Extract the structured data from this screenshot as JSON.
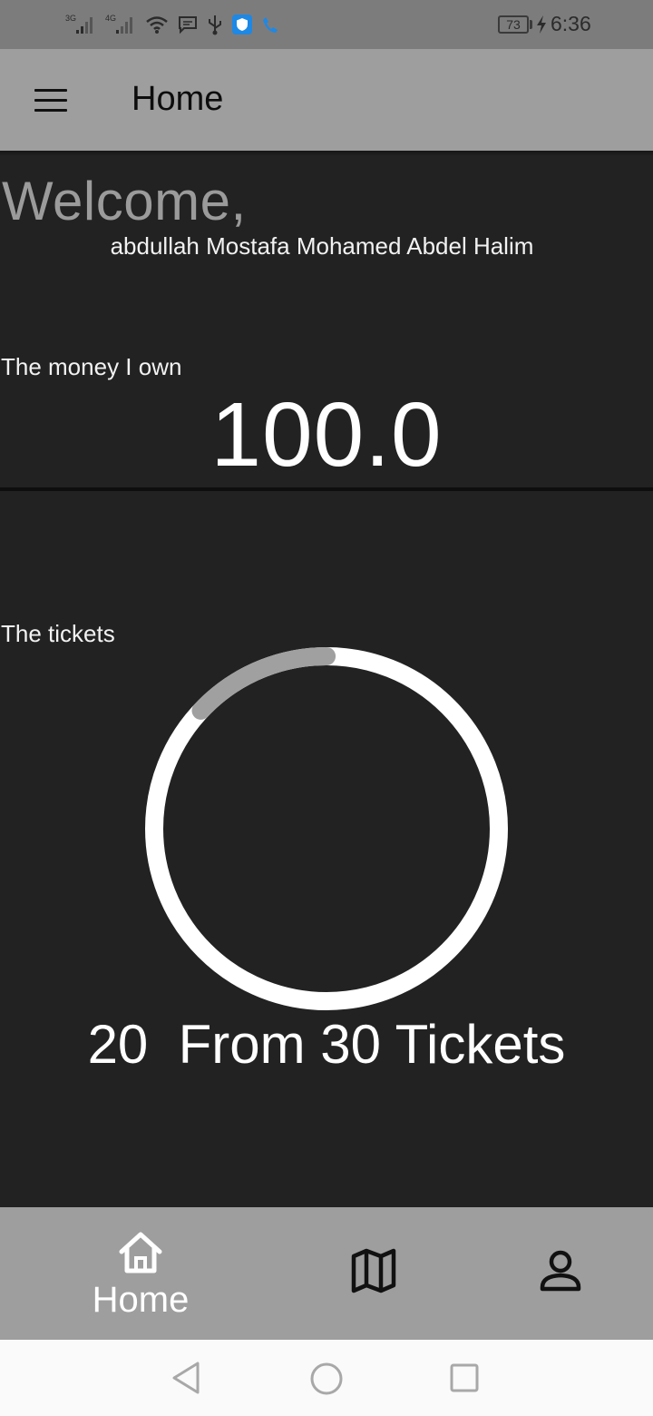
{
  "status_bar": {
    "signal_1_label": "3G",
    "signal_2_label": "4G",
    "battery_level": "73",
    "time": "6:36",
    "icons": [
      "signal-3g-icon",
      "signal-4g-icon",
      "wifi-icon",
      "message-icon",
      "usb-icon",
      "shield-app-icon",
      "phone-call-icon",
      "battery-icon",
      "charging-bolt-icon"
    ]
  },
  "app_bar": {
    "title": "Home",
    "menu_icon": "hamburger-menu-icon"
  },
  "main": {
    "welcome": "Welcome,",
    "user_name": "abdullah Mostafa Mohamed Abdel Halim",
    "money_label": "The money I own",
    "money_value": "100.0",
    "tickets_label": "The tickets",
    "tickets_used": 20,
    "tickets_total": 30,
    "tickets_text": "20  From 30 Tickets",
    "ring_progress_fraction": 0.13,
    "ring_colors": {
      "track": "#ffffff",
      "progress": "#a0a0a0"
    }
  },
  "bottom_nav": {
    "items": [
      {
        "id": "home",
        "icon": "home-icon",
        "label": "Home",
        "active": true
      },
      {
        "id": "map",
        "icon": "map-icon",
        "label": ""
      },
      {
        "id": "profile",
        "icon": "person-icon",
        "label": ""
      }
    ]
  },
  "system_nav": {
    "icons": [
      "back-triangle-icon",
      "home-circle-icon",
      "recents-square-icon"
    ]
  },
  "colors": {
    "background": "#222222",
    "app_bar": "#9e9e9e",
    "status_bar": "#7c7c7c",
    "text_primary": "#ffffff",
    "text_muted": "#9b9b9b"
  }
}
